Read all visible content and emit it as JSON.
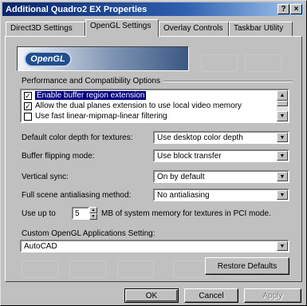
{
  "window": {
    "title": "Additional Quadro2 EX Properties",
    "help_button": "?",
    "close_button": "×"
  },
  "tabs": [
    {
      "label": "Direct3D Settings",
      "active": false
    },
    {
      "label": "OpenGL Settings",
      "active": true
    },
    {
      "label": "Overlay Controls",
      "active": false
    },
    {
      "label": "Taskbar Utility",
      "active": false
    }
  ],
  "logo": {
    "text": "OpenGL"
  },
  "perf_group": {
    "title": "Performance and Compatibility Options",
    "items": [
      {
        "label": "Enable buffer region extension",
        "checked": true,
        "selected": true
      },
      {
        "label": "Allow the dual planes extension to use local video memory",
        "checked": true,
        "selected": false
      },
      {
        "label": "Use fast linear-mipmap-linear filtering",
        "checked": false,
        "selected": false
      }
    ]
  },
  "settings": {
    "color_depth": {
      "label": "Default color depth for textures:",
      "value": "Use desktop color depth"
    },
    "buffer_flipping": {
      "label": "Buffer flipping mode:",
      "value": "Use block transfer"
    },
    "vsync": {
      "label": "Vertical sync:",
      "value": "On by default"
    },
    "antialiasing": {
      "label": "Full scene antialiasing method:",
      "value": "No antialiasing"
    },
    "memory": {
      "prefix": "Use up to",
      "value": "5",
      "suffix": "MB of system memory for textures in PCI mode."
    }
  },
  "custom_settings": {
    "label": "Custom OpenGL Applications Setting:",
    "value": "AutoCAD"
  },
  "restore_button": "Restore Defaults",
  "footer": {
    "ok": "OK",
    "cancel": "Cancel",
    "apply": "Apply"
  }
}
